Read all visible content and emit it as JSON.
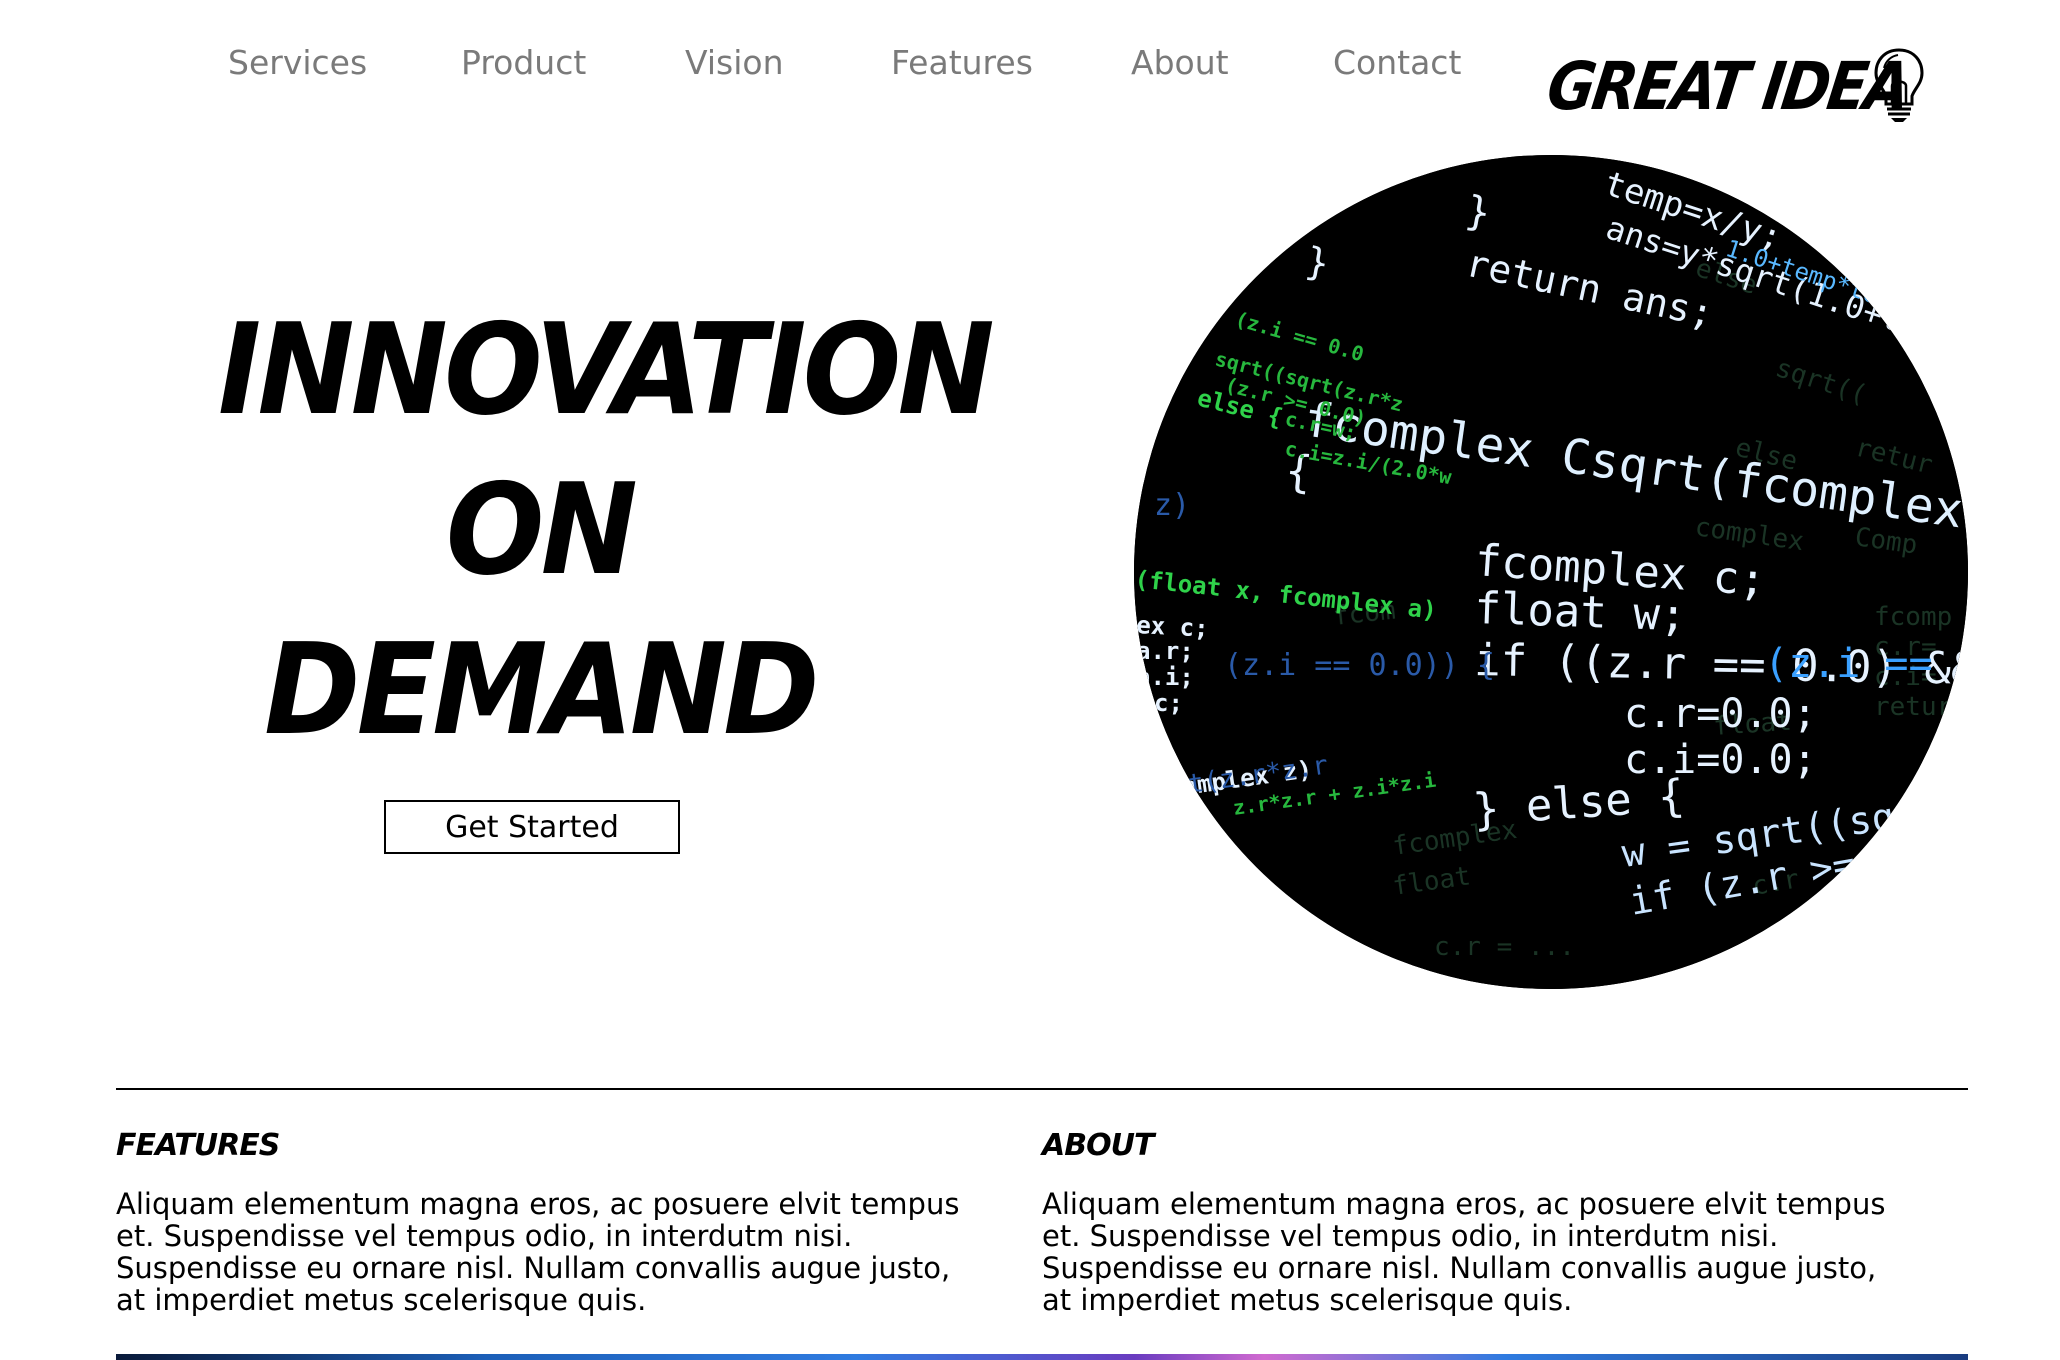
{
  "nav": {
    "items": [
      {
        "label": "Services"
      },
      {
        "label": "Product"
      },
      {
        "label": "Vision"
      },
      {
        "label": "Features"
      },
      {
        "label": "About"
      },
      {
        "label": "Contact"
      }
    ]
  },
  "logo": {
    "text": "GREAT IDEA",
    "icon": "lightbulb-icon"
  },
  "hero": {
    "title_lines": [
      "INNOVATION",
      "ON",
      "DEMAND"
    ],
    "cta_label": "Get Started",
    "image": {
      "code_lines": [
        "temp=x/y;",
        "}",
        "ans=y*sqrt(1.0+temp*te",
        "return ans;",
        "}",
        "fcomplex Csqrt(fcomplex z)",
        "{",
        "fcomplex c;",
        "float w;",
        "if ((z.r == 0.0) && (z.i == 0.0) {",
        "c.r=0.0;",
        "c.i=0.0;",
        "} else {",
        "w = sqrt((sqrt(z.r*z",
        "if (z.r >= 0.0){",
        "else {",
        "(float x, fcomplex a)",
        "ex c;",
        "a.r;",
        "a.i;",
        "c;",
        "omplex z)"
      ]
    }
  },
  "sections": {
    "features": {
      "heading": "Features",
      "body": "Aliquam elementum magna eros, ac posuere elvit tempus et. Suspendisse vel tempus odio, in interdutm nisi. Suspendisse eu ornare nisl. Nullam convallis augue justo, at imperdiet metus scelerisque quis."
    },
    "about": {
      "heading": "About",
      "body": "Aliquam elementum magna eros, ac posuere elvit tempus et. Suspendisse vel tempus odio, in interdutm nisi. Suspendisse eu ornare nisl. Nullam convallis augue justo, at imperdiet metus scelerisque quis."
    }
  },
  "colors": {
    "nav_text": "#7a7a7a",
    "text": "#000000",
    "background": "#ffffff",
    "code_bg": "#000000",
    "code_white": "#e6f2ff",
    "code_blue": "#3aa0ff",
    "code_green": "#2fd24a"
  }
}
